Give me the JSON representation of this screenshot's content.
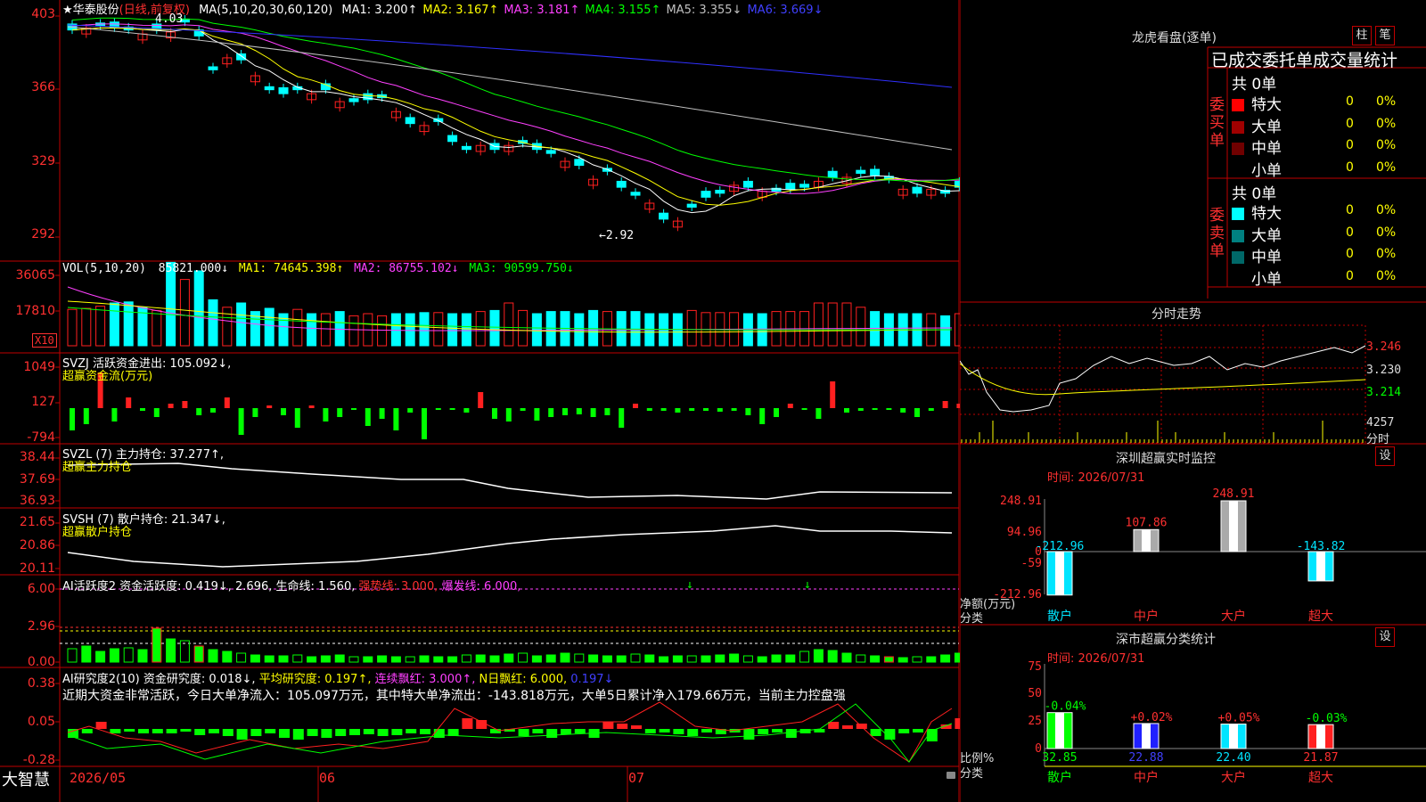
{
  "header": {
    "title": "★华泰股份",
    "mode": "(日线,前复权)",
    "ma_label": "MA(5,10,20,30,60,120)",
    "ma": [
      {
        "k": "MA1:",
        "v": "3.200↑",
        "c": "#ffffff"
      },
      {
        "k": "MA2:",
        "v": "3.167↑",
        "c": "#ffff00"
      },
      {
        "k": "MA3:",
        "v": "3.181↑",
        "c": "#ff40ff"
      },
      {
        "k": "MA4:",
        "v": "3.155↑",
        "c": "#00ff00"
      },
      {
        "k": "MA5:",
        "v": "3.355↓",
        "c": "#c0c0c0"
      },
      {
        "k": "MA6:",
        "v": "3.669↓",
        "c": "#4040ff"
      }
    ]
  },
  "price_axis": [
    "403",
    "366",
    "329",
    "292"
  ],
  "price_marks": {
    "high": "4.03",
    "low": "←2.92"
  },
  "vol": {
    "label": "VOL(5,10,20)",
    "value": "85821.000↓",
    "ma1": "MA1: 74645.398↑",
    "ma2": "MA2: 86755.102↓",
    "ma3": "MA3: 90599.750↓",
    "axis": [
      "36065",
      "17810"
    ],
    "unit": "X10"
  },
  "svzj": {
    "label": "SVZJ  活跃资金进出: 105.092↓,",
    "sub": "超赢资金流(万元)",
    "axis": [
      "1049",
      "127",
      "-794"
    ]
  },
  "svzl": {
    "label": "SVZL (7) 主力持仓: 37.277↑,",
    "sub": "超赢主力持仓",
    "axis": [
      "38.44",
      "37.69",
      "36.93"
    ]
  },
  "svsh": {
    "label": "SVSH (7) 散户持仓: 21.347↓,",
    "sub": "超赢散户持仓",
    "axis": [
      "21.65",
      "20.86",
      "20.11"
    ]
  },
  "ai1": {
    "label": "AI活跃度2 资金活跃度: 0.419↓, 2.696, 生命线: 1.560,",
    "strong": "强势线: 3.000,",
    "burst": "爆发线: 6.000,",
    "axis": [
      "6.00",
      "2.96",
      "0.00"
    ]
  },
  "ai2": {
    "label": "AI研究度2(10) 资金研究度: 0.018↓,",
    "avg": "平均研究度: 0.197↑,",
    "cont": "连续飘红: 3.000↑,",
    "nday": "N日飘红: 6.000,",
    "last": "0.197↓",
    "note": "近期大资金非常活跃，今日大单净流入：105.097万元，其中特大单净流出：-143.818万元，大单5日累计净入179.66万元，当前主力控盘强",
    "axis": [
      "0.38",
      "0.05",
      "-0.28"
    ]
  },
  "xaxis": {
    "left": "大智慧",
    "d1": "2026/05",
    "d2": "06",
    "d3": "07"
  },
  "right": {
    "lhb_title": "龙虎看盘(逐单)",
    "btn1": "柱",
    "btn2": "笔",
    "lhb_head": "已成交委托单成交量统计",
    "buy_label": "委买单",
    "sell_label": "委卖单",
    "buy_total": "共 0单",
    "sell_total": "共 0单",
    "buy_rows": [
      {
        "name": "特大",
        "n": "0",
        "p": "0%",
        "c": "#ff0000"
      },
      {
        "name": "大单",
        "n": "0",
        "p": "0%",
        "c": "#a00000"
      },
      {
        "name": "中单",
        "n": "0",
        "p": "0%",
        "c": "#700000"
      },
      {
        "name": "小单",
        "n": "0",
        "p": "0%",
        "c": "#000000"
      }
    ],
    "sell_rows": [
      {
        "name": "特大",
        "n": "0",
        "p": "0%",
        "c": "#00ffff"
      },
      {
        "name": "大单",
        "n": "0",
        "p": "0%",
        "c": "#008080"
      },
      {
        "name": "中单",
        "n": "0",
        "p": "0%",
        "c": "#006868"
      },
      {
        "name": "小单",
        "n": "0",
        "p": "0%",
        "c": "#000000"
      }
    ],
    "fs_title": "分时走势",
    "fs_axis": [
      "3.246",
      "3.230",
      "3.214"
    ],
    "fs_vol": "4257",
    "fs_unit": "分时",
    "mon_title": "深圳超赢实时监控",
    "mon_btn": "设",
    "mon_time": "时间: 2026/07/31",
    "mon_axis": [
      "248.91",
      "94.96",
      "0",
      "-59",
      "-212.96"
    ],
    "mon_ylabel": "净额(万元)",
    "mon_xlabel": "分类",
    "mon_bars": [
      {
        "cat": "散户",
        "v": -212.96,
        "label": "-212.96"
      },
      {
        "cat": "中户",
        "v": 107.86,
        "label": "107.86"
      },
      {
        "cat": "大户",
        "v": 248.91,
        "label": "248.91"
      },
      {
        "cat": "超大",
        "v": -143.82,
        "label": "-143.82"
      }
    ],
    "stat_title": "深市超赢分类统计",
    "stat_btn": "设",
    "stat_time": "时间: 2026/07/31",
    "stat_axis": [
      "75",
      "50",
      "25",
      "0"
    ],
    "stat_ylabel": "比例%",
    "stat_xlabel": "分类",
    "stat_bars": [
      {
        "cat": "散户",
        "v": 32.85,
        "chg": "-0.04%",
        "label": "32.85"
      },
      {
        "cat": "中户",
        "v": 22.88,
        "chg": "+0.02%",
        "label": "22.88"
      },
      {
        "cat": "大户",
        "v": 22.4,
        "chg": "+0.05%",
        "label": "22.40"
      },
      {
        "cat": "超大",
        "v": 21.87,
        "chg": "-0.03%",
        "label": "21.87"
      }
    ]
  },
  "colors": {
    "up": "#ff2020",
    "down": "#00ffff",
    "grid": "#c00000",
    "yellow": "#ffff00",
    "green": "#00ff00"
  }
}
